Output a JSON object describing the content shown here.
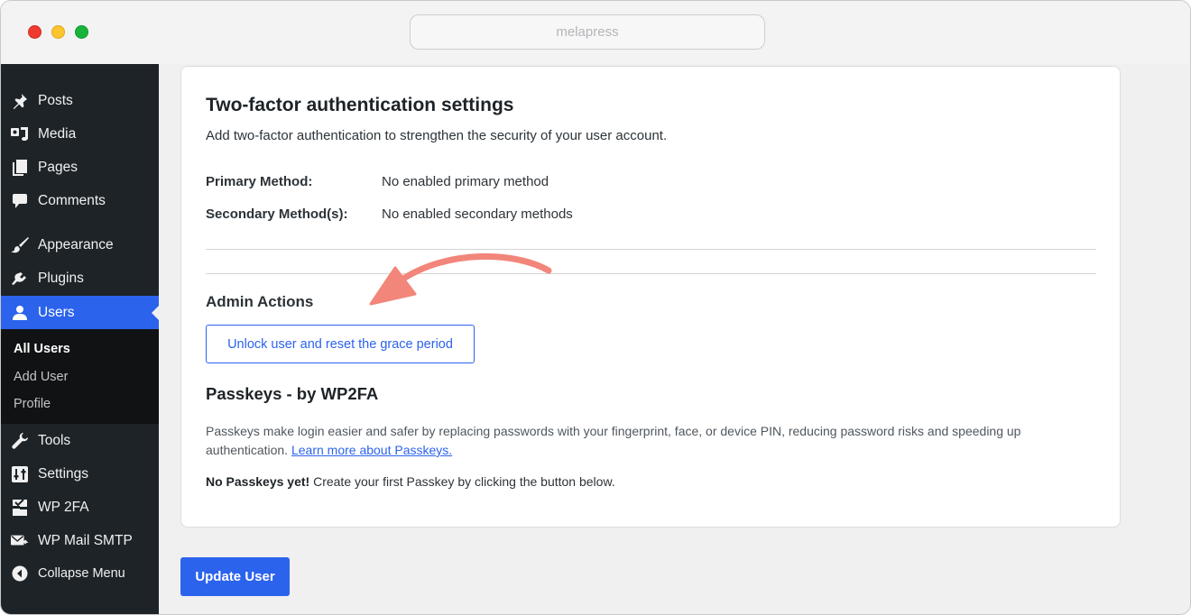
{
  "browser": {
    "url": "melapress"
  },
  "sidebar": {
    "items": [
      {
        "label": "Posts",
        "icon": "pushpin-icon"
      },
      {
        "label": "Media",
        "icon": "media-icon"
      },
      {
        "label": "Pages",
        "icon": "pages-icon"
      },
      {
        "label": "Comments",
        "icon": "comment-icon"
      },
      {
        "label": "Appearance",
        "icon": "brush-icon"
      },
      {
        "label": "Plugins",
        "icon": "plug-icon"
      },
      {
        "label": "Users",
        "icon": "user-icon",
        "active": true
      },
      {
        "label": "Tools",
        "icon": "wrench-icon"
      },
      {
        "label": "Settings",
        "icon": "settings-icon"
      },
      {
        "label": "WP 2FA",
        "icon": "wp2fa-icon"
      },
      {
        "label": "WP Mail SMTP",
        "icon": "mail-icon"
      },
      {
        "label": "Collapse Menu",
        "icon": "collapse-icon"
      }
    ],
    "submenu": [
      {
        "label": "All Users",
        "current": true
      },
      {
        "label": "Add User"
      },
      {
        "label": "Profile"
      }
    ]
  },
  "settings": {
    "title": "Two-factor authentication settings",
    "description": "Add two-factor authentication to strengthen the security of your user account.",
    "primary_label": "Primary Method:",
    "primary_value": "No enabled primary method",
    "secondary_label": "Secondary Method(s):",
    "secondary_value": "No enabled secondary methods",
    "admin_actions_heading": "Admin Actions",
    "unlock_button": "Unlock user and reset the grace period",
    "passkeys_heading": "Passkeys - by WP2FA",
    "passkeys_text": "Passkeys make login easier and safer by replacing passwords with your fingerprint, face, or device PIN, reducing password risks and speeding up authentication.",
    "passkeys_link": "Learn more about Passkeys.",
    "no_passkeys_bold": "No Passkeys yet!",
    "no_passkeys_text": "Create your first Passkey by clicking the button below."
  },
  "footer": {
    "update_button": "Update User"
  },
  "colors": {
    "accent": "#2c63ec",
    "sidebar": "#1d2327",
    "arrow": "#f2867a"
  }
}
